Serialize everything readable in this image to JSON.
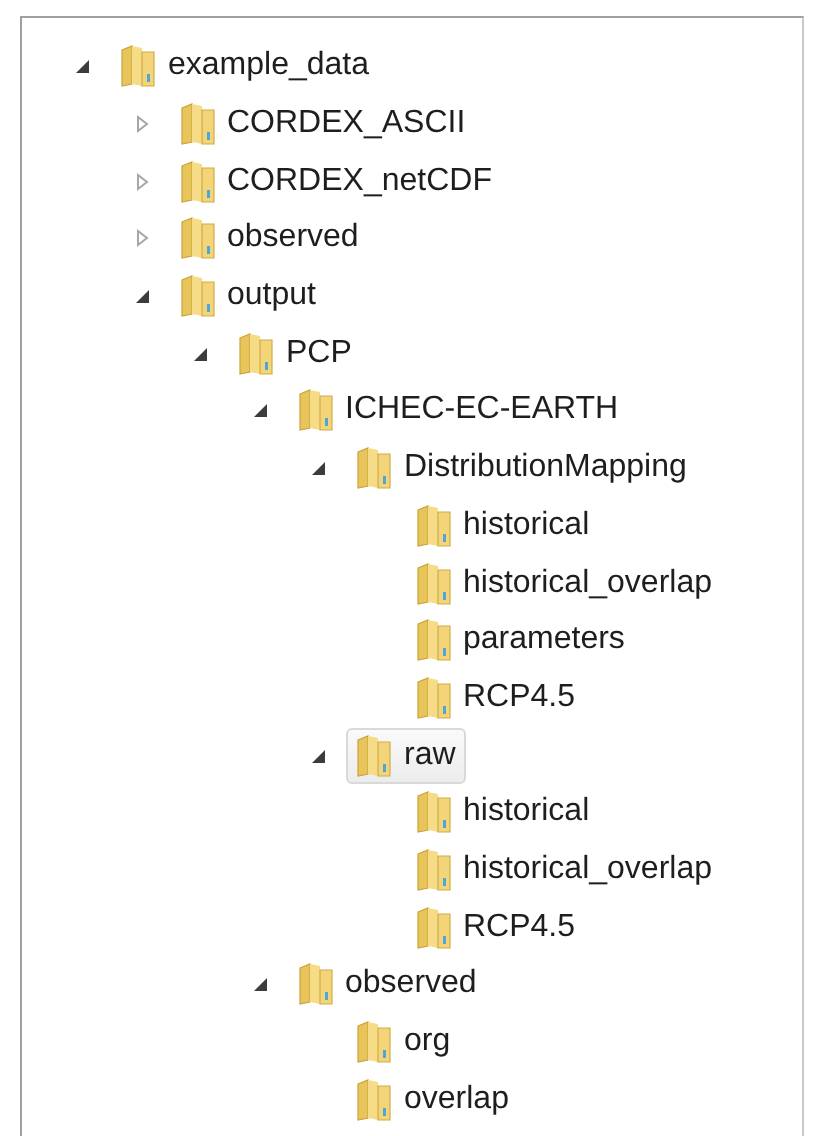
{
  "tree": [
    {
      "name": "example_data",
      "expanded": true,
      "selected": false,
      "children": [
        {
          "name": "CORDEX_ASCII",
          "expanded": false,
          "selected": false
        },
        {
          "name": "CORDEX_netCDF",
          "expanded": false,
          "selected": false
        },
        {
          "name": "observed",
          "expanded": false,
          "selected": false
        },
        {
          "name": "output",
          "expanded": true,
          "selected": false,
          "children": [
            {
              "name": "PCP",
              "expanded": true,
              "selected": false,
              "children": [
                {
                  "name": "ICHEC-EC-EARTH",
                  "expanded": true,
                  "selected": false,
                  "children": [
                    {
                      "name": "DistributionMapping",
                      "expanded": true,
                      "selected": false,
                      "children": [
                        {
                          "name": "historical",
                          "selected": false
                        },
                        {
                          "name": "historical_overlap",
                          "selected": false
                        },
                        {
                          "name": "parameters",
                          "selected": false
                        },
                        {
                          "name": "RCP4.5",
                          "selected": false
                        }
                      ]
                    },
                    {
                      "name": "raw",
                      "expanded": true,
                      "selected": true,
                      "children": [
                        {
                          "name": "historical",
                          "selected": false
                        },
                        {
                          "name": "historical_overlap",
                          "selected": false
                        },
                        {
                          "name": "RCP4.5",
                          "selected": false
                        }
                      ]
                    }
                  ]
                },
                {
                  "name": "observed",
                  "expanded": true,
                  "selected": false,
                  "children": [
                    {
                      "name": "org",
                      "selected": false
                    },
                    {
                      "name": "overlap",
                      "selected": false
                    }
                  ]
                }
              ]
            }
          ]
        }
      ]
    }
  ]
}
